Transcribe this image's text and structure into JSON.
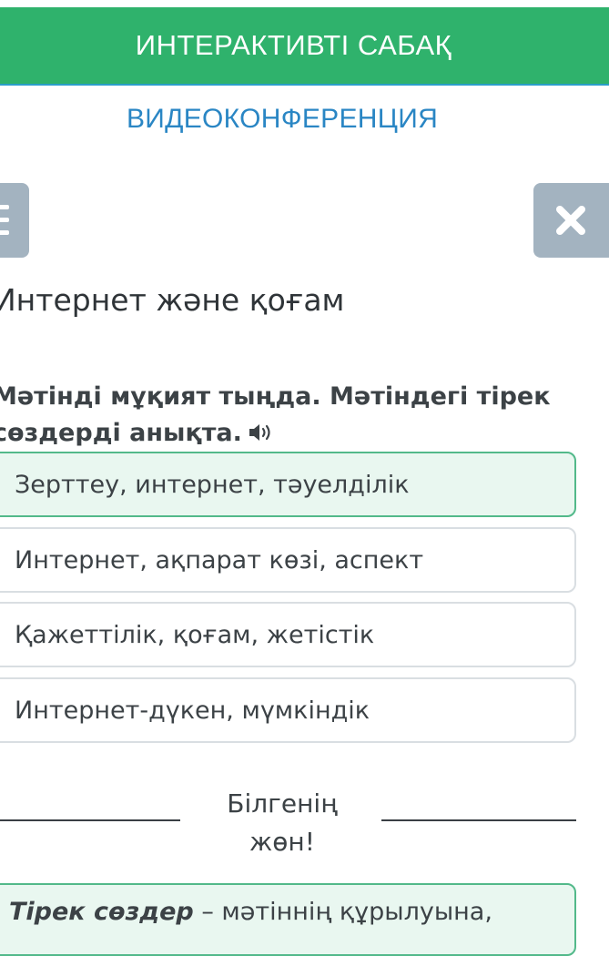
{
  "header": {
    "banner_title": "ИНТЕРАКТИВТІ САБАҚ",
    "video_link": "ВИДЕОКОНФЕРЕНЦИЯ",
    "menu_icon": "menu-icon",
    "close_icon": "close-icon"
  },
  "lesson": {
    "title": "Интернет және қоғам"
  },
  "question": {
    "text": "Мәтінді мұқият тыңда. Мәтіндегі тірек сөздерді анықта.",
    "audio_icon": "speaker-icon"
  },
  "options": [
    {
      "label": "Зерттеу, интернет, тәуелділік",
      "selected": true
    },
    {
      "label": "Интернет, ақпарат көзі, аспект",
      "selected": false
    },
    {
      "label": "Қажеттілік, қоғам, жетістік",
      "selected": false
    },
    {
      "label": "Интернет-дүкен, мүмкіндік",
      "selected": false
    }
  ],
  "feedback": {
    "line1": "Білгенің",
    "line2": "жөн!"
  },
  "explanation": {
    "term": "Тірек сөздер",
    "text": " – мәтіннің құрылуына,"
  },
  "colors": {
    "banner": "#2fb26c",
    "link": "#2a86c4",
    "button_grey": "#a3b3c0",
    "selected_bg": "#e9f7f0",
    "selected_border": "#52b98a"
  }
}
